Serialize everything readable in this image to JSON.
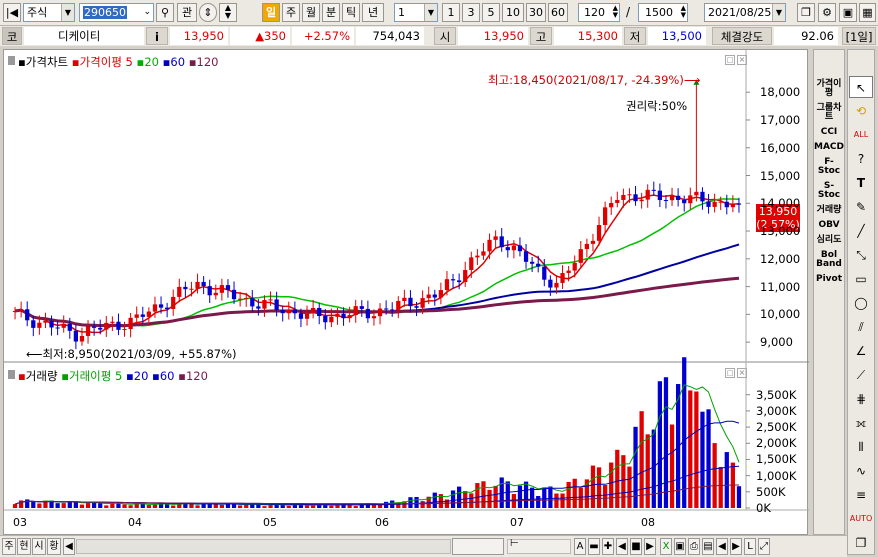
{
  "toolbar": {
    "market": "주식",
    "code": "290650",
    "btn_gwan": "관",
    "period_tabs": [
      "일",
      "주",
      "월",
      "분",
      "틱",
      "년"
    ],
    "interval_value": "1",
    "quick_counts": [
      "1",
      "3",
      "5",
      "10",
      "30",
      "60"
    ],
    "count_value": "120",
    "total_value": "1500",
    "date_value": "2021/08/25",
    "slash": "/"
  },
  "quote": {
    "code_label": "코",
    "name": "디케이티",
    "info_icon": "i",
    "price": "13,950",
    "change": "▲350",
    "change_pct": "+2.57%",
    "volume": "754,043",
    "open_label": "시",
    "open": "13,950",
    "high_label": "고",
    "high": "15,300",
    "low_label": "저",
    "low": "13,500",
    "strength_label": "체결강도",
    "strength": "92.06",
    "period_badge": "[1일]"
  },
  "price_panel": {
    "legend": [
      {
        "text": "가격차트",
        "color": "#000000"
      },
      {
        "text": "가격이평 5",
        "color": "#e00000"
      },
      {
        "text": "20",
        "color": "#00b000"
      },
      {
        "text": "60",
        "color": "#0000c0"
      },
      {
        "text": "120",
        "color": "#7a1a4a"
      }
    ],
    "high_note": "최고:18,450(2021/08/17, -24.39%)⟶",
    "low_note": "⟵최저:8,950(2021/03/09, +55.87%)",
    "rights_note": "권리락:50%",
    "y_ticks": [
      "18,000",
      "17,000",
      "16,000",
      "15,000",
      "14,000",
      "13,000",
      "12,000",
      "11,000",
      "10,000",
      "9,000"
    ],
    "current_price": "13,950",
    "current_pct": "(2.57%)"
  },
  "volume_panel": {
    "legend": [
      {
        "text": "거래량",
        "color": "#000000"
      },
      {
        "text": "거래이평 5",
        "color": "#00a000"
      },
      {
        "text": "20",
        "color": "#0000c0"
      },
      {
        "text": "60",
        "color": "#0000c0"
      },
      {
        "text": "120",
        "color": "#7a1a4a"
      }
    ],
    "y_ticks": [
      "3,500K",
      "3,000K",
      "2,500K",
      "2,000K",
      "1,500K",
      "1,000K",
      "500K",
      "0K"
    ]
  },
  "x_ticks": [
    "03",
    "04",
    "05",
    "06",
    "07",
    "08"
  ],
  "indicators": [
    "가격이평",
    "그룹차트",
    "CCI",
    "MACD",
    "F-Stoc",
    "S-Stoc",
    "거래량",
    "OBV",
    "심리도",
    "Bol Band",
    "Pivot"
  ],
  "bottom": {
    "tabs": [
      "주",
      "현",
      "시",
      "황"
    ],
    "zoom_labels": [
      "A",
      "▬",
      "✚",
      "◀",
      "■",
      "▶"
    ]
  },
  "colors": {
    "up": "#e00000",
    "down": "#0000d0",
    "ma5": "#e00000",
    "ma20": "#00c000",
    "ma60": "#0000a0",
    "ma120": "#7a1a4a"
  },
  "chart_data": {
    "type": "candlestick",
    "x": [
      "2021-03",
      "2021-04",
      "2021-05",
      "2021-06",
      "2021-07",
      "2021-08"
    ],
    "price_points": [
      {
        "label": "2021-03 start",
        "close": 10000
      },
      {
        "label": "2021-03 low",
        "close": 9300
      },
      {
        "label": "2021-04",
        "close": 9800
      },
      {
        "label": "2021-04 late",
        "close": 11100
      },
      {
        "label": "2021-05",
        "close": 10400
      },
      {
        "label": "2021-06",
        "close": 9900
      },
      {
        "label": "2021-06 late",
        "close": 10100
      },
      {
        "label": "2021-07 early",
        "close": 10700
      },
      {
        "label": "2021-07 mid",
        "close": 12800
      },
      {
        "label": "2021-07 late",
        "close": 11000
      },
      {
        "label": "2021-08 early",
        "close": 14300
      },
      {
        "label": "2021-08-17",
        "close": 14200
      },
      {
        "label": "2021-08-25",
        "close": 13950
      }
    ],
    "volume_k": [
      200,
      150,
      100,
      120,
      90,
      80,
      110,
      350,
      700,
      450,
      1300,
      3600,
      750
    ],
    "high": {
      "value": 18450,
      "date": "2021/08/17"
    },
    "low": {
      "value": 8950,
      "date": "2021/03/09"
    },
    "ylim": [
      8500,
      18800
    ],
    "volume_ylim": [
      0,
      3800
    ]
  }
}
